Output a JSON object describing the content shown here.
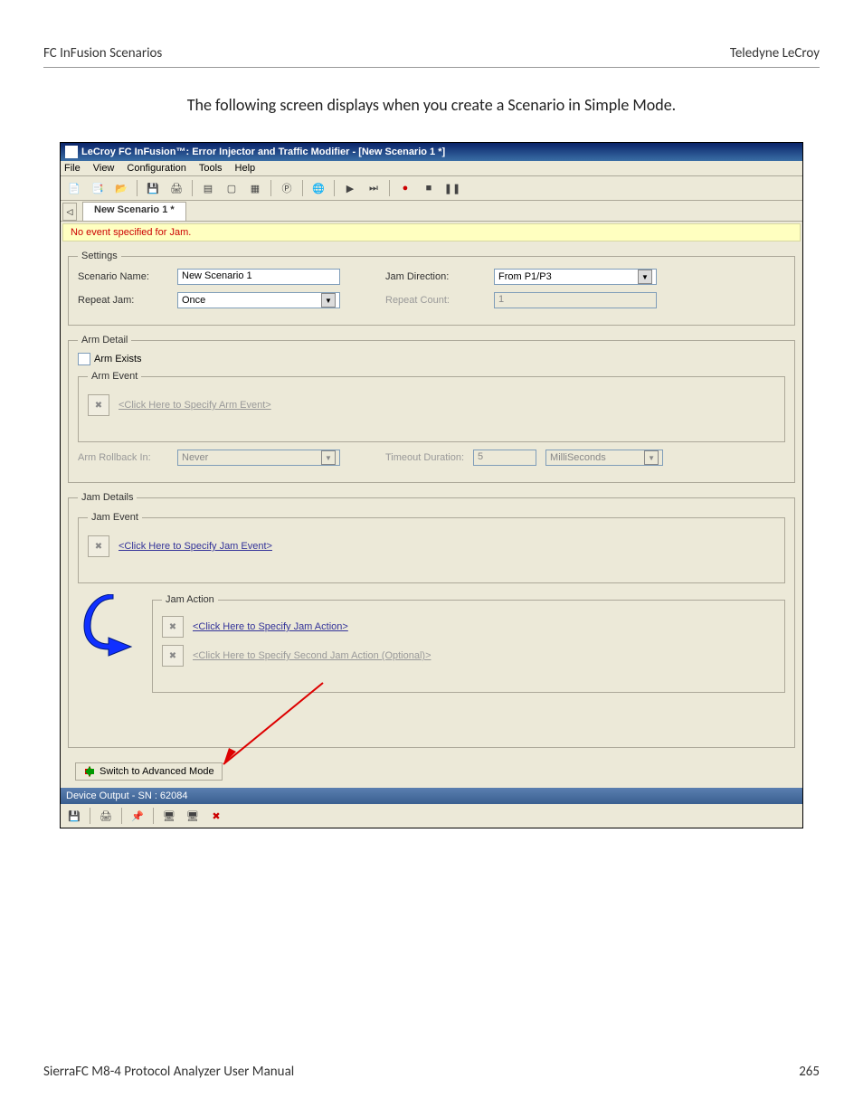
{
  "page": {
    "header_left": "FC InFusion Scenarios",
    "header_right": "Teledyne LeCroy",
    "intro": "The following screen displays when you create a Scenario in Simple Mode.",
    "footer_left": "SierraFC M8-4 Protocol Analyzer User Manual",
    "footer_right": "265"
  },
  "app": {
    "title": "LeCroy FC InFusion™: Error Injector and Traffic Modifier - [New Scenario 1 *]",
    "menus": [
      "File",
      "View",
      "Configuration",
      "Tools",
      "Help"
    ],
    "tab": "New Scenario 1 *",
    "warning": "No event specified for Jam.",
    "settings": {
      "legend": "Settings",
      "scenario_name_label": "Scenario Name:",
      "scenario_name_value": "New Scenario 1",
      "jam_direction_label": "Jam Direction:",
      "jam_direction_value": "From P1/P3",
      "repeat_jam_label": "Repeat Jam:",
      "repeat_jam_value": "Once",
      "repeat_count_label": "Repeat Count:",
      "repeat_count_value": "1"
    },
    "arm": {
      "legend": "Arm Detail",
      "arm_exists_label": "Arm Exists",
      "arm_event_legend": "Arm Event",
      "arm_event_link": "<Click Here to Specify Arm Event>",
      "rollback_label": "Arm Rollback In:",
      "rollback_value": "Never",
      "timeout_label": "Timeout Duration:",
      "timeout_value": "5",
      "timeout_unit": "MilliSeconds"
    },
    "jam": {
      "legend": "Jam Details",
      "event_legend": "Jam Event",
      "event_link": "<Click Here to Specify Jam Event>",
      "action_legend": "Jam Action",
      "action_link": "<Click Here to Specify Jam Action>",
      "action2_link": "<Click Here to Specify Second Jam Action (Optional)>"
    },
    "advanced_btn": "Switch to Advanced Mode",
    "status": "Device Output - SN : 62084"
  }
}
